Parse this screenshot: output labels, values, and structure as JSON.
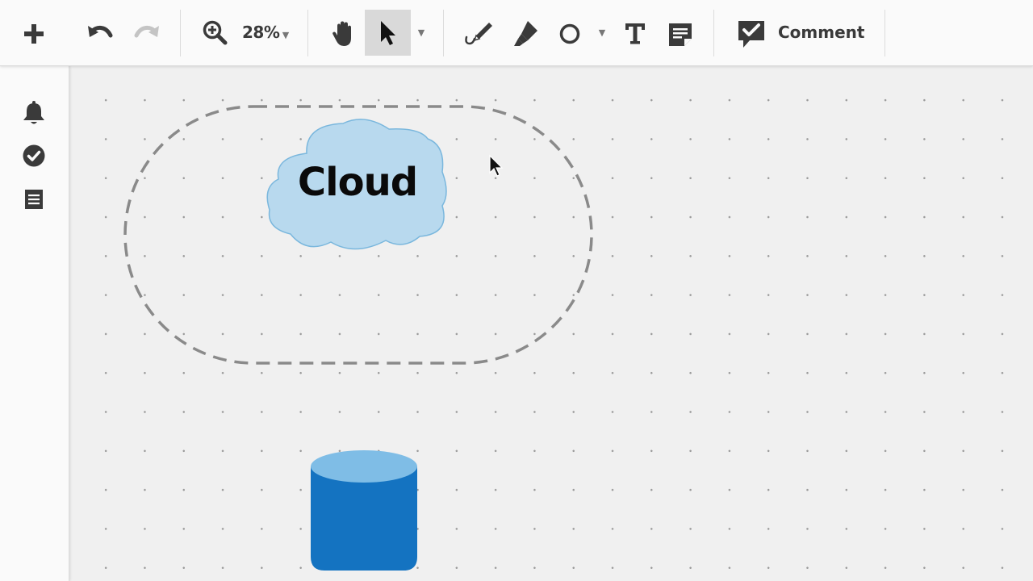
{
  "toolbar": {
    "zoom_level": "28%",
    "comment_label": "Comment"
  },
  "canvas": {
    "cloud_text": "Cloud"
  },
  "icons": {
    "add": "plus-icon",
    "undo": "undo-icon",
    "redo": "redo-icon",
    "zoom": "zoom-in-icon",
    "hand": "hand-icon",
    "select": "pointer-icon",
    "pen": "pen-icon",
    "highlighter": "highlighter-icon",
    "shape": "circle-icon",
    "text": "text-icon",
    "note": "sticky-note-icon",
    "comment": "comment-icon",
    "notifications": "bell-icon",
    "tasks": "check-circle-icon",
    "list": "list-icon"
  },
  "colors": {
    "cloud_fill": "#b8d9ee",
    "cloud_stroke": "#7ab7dd",
    "cylinder_body": "#1473c1",
    "cylinder_top": "#7fbde6",
    "dashed_border": "#8a8a8a",
    "active_tool_bg": "#d9d9d9",
    "icon": "#3a3a3a"
  }
}
